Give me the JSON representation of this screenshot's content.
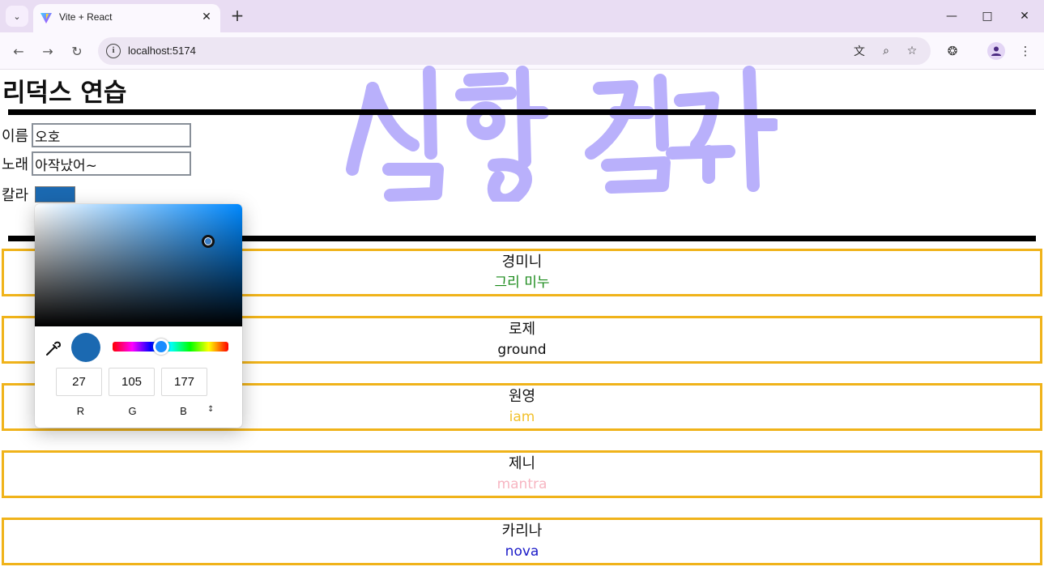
{
  "browser": {
    "tab_title": "Vite + React",
    "url": "localhost:5174"
  },
  "page": {
    "heading": "리덕스 연습",
    "watermark": "실행 결과",
    "form": {
      "name_label": "이름",
      "name_value": "오호",
      "song_label": "노래",
      "song_value": "아작났어~",
      "color_label": "칼라",
      "color_value": "#1b69b1"
    },
    "picker": {
      "r": "27",
      "g": "105",
      "b": "177",
      "r_label": "R",
      "g_label": "G",
      "b_label": "B",
      "selected_color": "#1b69b1"
    },
    "cards": [
      {
        "name": "경미니",
        "song": "그리 미누",
        "color": "#1a8a1a"
      },
      {
        "name": "로제",
        "song": "ground",
        "color": "#111111"
      },
      {
        "name": "원영",
        "song": "iam",
        "color": "#f2c12e"
      },
      {
        "name": "제니",
        "song": "mantra",
        "color": "#f7b6c2"
      },
      {
        "name": "카리나",
        "song": "nova",
        "color": "#1a1ac8"
      }
    ]
  }
}
